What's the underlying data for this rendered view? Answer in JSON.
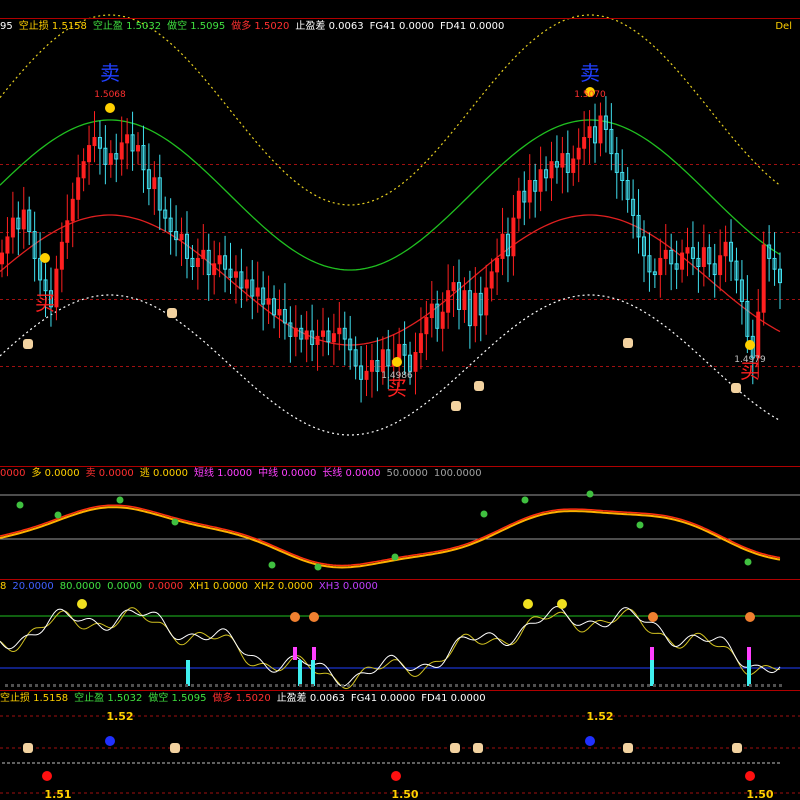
{
  "colors": {
    "background": "#000000",
    "separator": "#b00000",
    "up_candle": "#ff2020",
    "down_candle": "#40e0f0",
    "band_outer": "#e8d020",
    "band_mid": "#20c020",
    "band_inner": "#e02020",
    "band_lower": "#ffffff",
    "gold": "#ffd000",
    "blue_label": "#2040ff",
    "red_label": "#ff2020"
  },
  "panel1": {
    "header": [
      {
        "text": "95",
        "color": "#ffffff"
      },
      {
        "text": "空止损 1.5158",
        "color": "#ffd000"
      },
      {
        "text": "空止盈 1.5032",
        "color": "#40e040"
      },
      {
        "text": "做空 1.5095",
        "color": "#40e040"
      },
      {
        "text": "做多 1.5020",
        "color": "#ff3030"
      },
      {
        "text": "止盈差 0.0063",
        "color": "#ffffff"
      },
      {
        "text": "FG41 0.0000",
        "color": "#ffffff"
      },
      {
        "text": "FD41 0.0000",
        "color": "#ffffff"
      }
    ],
    "corner_label": "Del",
    "annotations": [
      {
        "kind": "sell",
        "label": "卖",
        "value": "1.5068"
      },
      {
        "kind": "sell",
        "label": "卖",
        "value": "1.5070"
      },
      {
        "kind": "buy",
        "label": "买",
        "value": ""
      },
      {
        "kind": "buy",
        "label": "买",
        "value": "1.4986"
      },
      {
        "kind": "buy",
        "label": "买",
        "value": "1.4979"
      }
    ]
  },
  "panel2": {
    "header": [
      {
        "text": "0000",
        "color": "#ff3030"
      },
      {
        "text": "多 0.0000",
        "color": "#ffd000"
      },
      {
        "text": "卖 0.0000",
        "color": "#ff3030"
      },
      {
        "text": "逃 0.0000",
        "color": "#ffd000"
      },
      {
        "text": "短线 1.0000",
        "color": "#ff40ff"
      },
      {
        "text": "中线 0.0000",
        "color": "#ff40ff"
      },
      {
        "text": "长线 0.0000",
        "color": "#ff40ff"
      },
      {
        "text": "50.0000",
        "color": "#a0a0a0"
      },
      {
        "text": "100.0000",
        "color": "#a0a0a0"
      }
    ]
  },
  "panel3": {
    "header": [
      {
        "text": "8",
        "color": "#ffd000"
      },
      {
        "text": "20.0000",
        "color": "#4060ff"
      },
      {
        "text": "80.0000",
        "color": "#40e040"
      },
      {
        "text": "0.0000",
        "color": "#40e040"
      },
      {
        "text": "0.0000",
        "color": "#ff3030"
      },
      {
        "text": "XH1 0.0000",
        "color": "#ffd000"
      },
      {
        "text": "XH2 0.0000",
        "color": "#ffd000"
      },
      {
        "text": "XH3 0.0000",
        "color": "#c040ff"
      }
    ]
  },
  "panel4": {
    "header": [
      {
        "text": "空止损 1.5158",
        "color": "#ffd000"
      },
      {
        "text": "空止盈 1.5032",
        "color": "#40e040"
      },
      {
        "text": "做空 1.5095",
        "color": "#40e040"
      },
      {
        "text": "做多 1.5020",
        "color": "#ff3030"
      },
      {
        "text": "止盈差 0.0063",
        "color": "#ffffff"
      },
      {
        "text": "FG41 0.0000",
        "color": "#ffffff"
      },
      {
        "text": "FD41 0.0000",
        "color": "#ffffff"
      }
    ],
    "labels": [
      "1.52",
      "1.52",
      "1.51",
      "1.50",
      "1.50"
    ]
  },
  "chart_data": {
    "type": "candlestick",
    "price_ylim": [
      1.4955,
      1.5115
    ],
    "closes": [
      1.5032,
      1.5038,
      1.5045,
      1.5041,
      1.5048,
      1.504,
      1.503,
      1.5022,
      1.5018,
      1.5012,
      1.5026,
      1.5036,
      1.5044,
      1.5052,
      1.506,
      1.5066,
      1.5072,
      1.5075,
      1.5071,
      1.5065,
      1.5069,
      1.5067,
      1.5073,
      1.5076,
      1.507,
      1.5072,
      1.5063,
      1.5056,
      1.506,
      1.5048,
      1.5045,
      1.504,
      1.5037,
      1.5039,
      1.503,
      1.5027,
      1.503,
      1.5033,
      1.5024,
      1.5028,
      1.5031,
      1.5026,
      1.5023,
      1.5025,
      1.5019,
      1.5022,
      1.5016,
      1.5019,
      1.5013,
      1.5015,
      1.5009,
      1.5011,
      1.5006,
      1.5001,
      1.5004,
      1.5,
      1.5003,
      1.4998,
      1.5001,
      1.5003,
      1.4999,
      1.5002,
      1.5004,
      1.5,
      1.4996,
      1.499,
      1.4985,
      1.4988,
      1.4992,
      1.4988,
      1.4996,
      1.499,
      1.4992,
      1.4998,
      1.4994,
      1.4988,
      1.4995,
      1.5002,
      1.5008,
      1.5013,
      1.5004,
      1.501,
      1.5018,
      1.5021,
      1.5011,
      1.5018,
      1.5005,
      1.5017,
      1.5009,
      1.5019,
      1.5025,
      1.503,
      1.5039,
      1.5031,
      1.5045,
      1.5055,
      1.5051,
      1.5059,
      1.5055,
      1.5063,
      1.506,
      1.5066,
      1.5064,
      1.5069,
      1.5062,
      1.5067,
      1.5071,
      1.5075,
      1.5079,
      1.5073,
      1.5083,
      1.5078,
      1.5069,
      1.5062,
      1.5059,
      1.5052,
      1.5046,
      1.5038,
      1.5031,
      1.5025,
      1.5024,
      1.503,
      1.5033,
      1.5028,
      1.5026,
      1.5032,
      1.5034,
      1.503,
      1.5027,
      1.5034,
      1.5028,
      1.5024,
      1.5031,
      1.5036,
      1.5029,
      1.5022,
      1.5014,
      1.5001,
      1.4993,
      1.501,
      1.5035,
      1.503,
      1.5026,
      1.5021
    ],
    "bands": {
      "outer_upper": "dotted yellow",
      "middle_upper": "solid green",
      "middle_lower": "solid red",
      "outer_lower": "dotted white"
    }
  }
}
